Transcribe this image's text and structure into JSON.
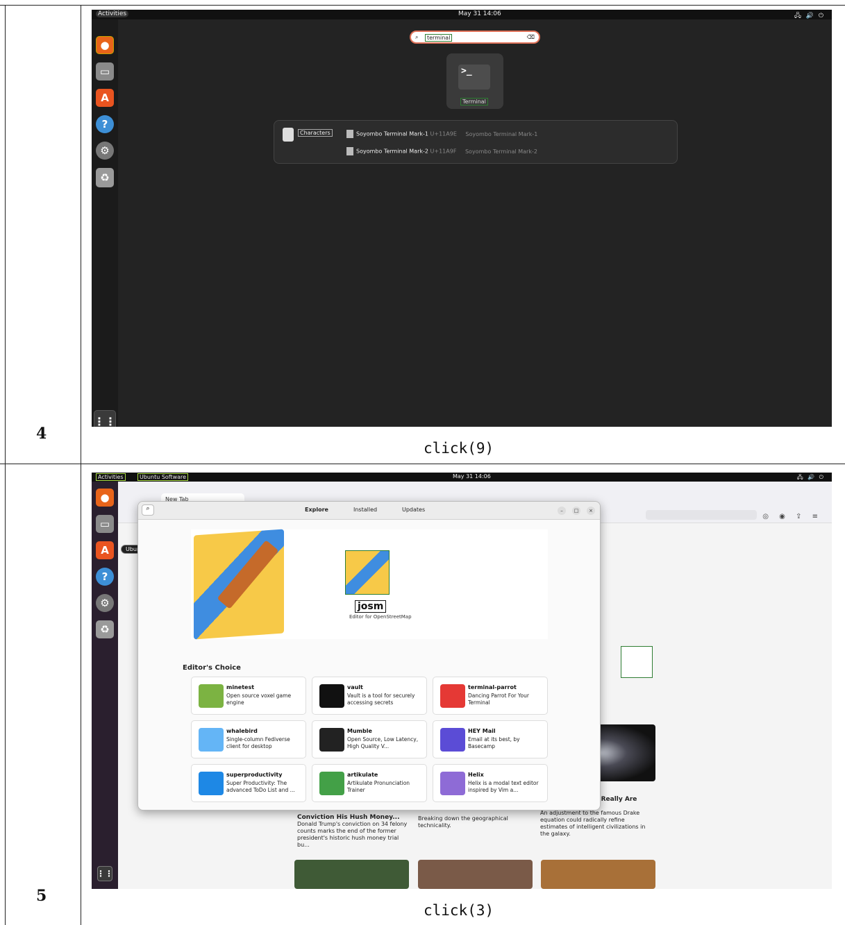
{
  "steps": [
    {
      "number": "4",
      "action": "click(9)",
      "topbar": {
        "activities": "Activities",
        "clock": "May 31 14:06"
      },
      "dock_icons": [
        "firefox-icon",
        "files-icon",
        "software-icon",
        "help-icon",
        "settings-icon",
        "trash-icon"
      ],
      "search": {
        "query": "terminal"
      },
      "app_result": {
        "label": "Terminal",
        "glyph": ">_"
      },
      "characters": {
        "label": "Characters",
        "rows": [
          {
            "name": "Soyombo Terminal Mark-1",
            "code": "U+11A9E",
            "extra": "Soyombo Terminal Mark-1"
          },
          {
            "name": "Soyombo Terminal Mark-2",
            "code": "U+11A9F",
            "extra": "Soyombo Terminal Mark-2"
          }
        ]
      }
    },
    {
      "number": "5",
      "action": "click(3)",
      "topbar": {
        "activities": "Activities",
        "app": "Ubuntu Software",
        "clock": "May 31 14:06"
      },
      "browser": {
        "tab": "New Tab"
      },
      "dock_tooltip": "Ubuntu Software",
      "software": {
        "tabs": [
          "Explore",
          "Installed",
          "Updates"
        ],
        "banner": {
          "name": "josm",
          "description": "Editor for OpenStreetMap"
        },
        "section": "Editor's Choice",
        "cards": [
          {
            "name": "minetest",
            "desc": "Open source voxel game engine",
            "color": "#7cb342"
          },
          {
            "name": "vault",
            "desc": "Vault is a tool for securely accessing secrets",
            "color": "#111111"
          },
          {
            "name": "terminal-parrot",
            "desc": "Dancing Parrot For Your Terminal",
            "color": "#e53935"
          },
          {
            "name": "whalebird",
            "desc": "Single-column Fediverse client for desktop",
            "color": "#64b5f6"
          },
          {
            "name": "Mumble",
            "desc": "Open Source, Low Latency, High Quality V...",
            "color": "#222222"
          },
          {
            "name": "HEY Mail",
            "desc": "Email at its best, by Basecamp",
            "color": "#5b4cd6"
          },
          {
            "name": "superproductivity",
            "desc": "Super Productivity: The advanced ToDo List and ...",
            "color": "#1e88e5"
          },
          {
            "name": "artikulate",
            "desc": "Artikulate Pronunciation Trainer",
            "color": "#43a047"
          },
          {
            "name": "Helix",
            "desc": "Helix is a modal text editor inspired by Vim a...",
            "color": "#8e6bd6"
          }
        ]
      },
      "news": [
        {
          "title": "Conviction His Hush Money...",
          "text": "Donald Trump's conviction on 34 felony counts marks the end of the former president's historic hush money trial bu..."
        },
        {
          "title": "",
          "text": "Breaking down the geographical technicality."
        },
        {
          "title": "on Alien ests We Really Are Alone the Galaxy",
          "text": "An adjustment to the famous Drake equation could radically refine estimates of intelligent civilizations in the galaxy."
        }
      ]
    }
  ]
}
